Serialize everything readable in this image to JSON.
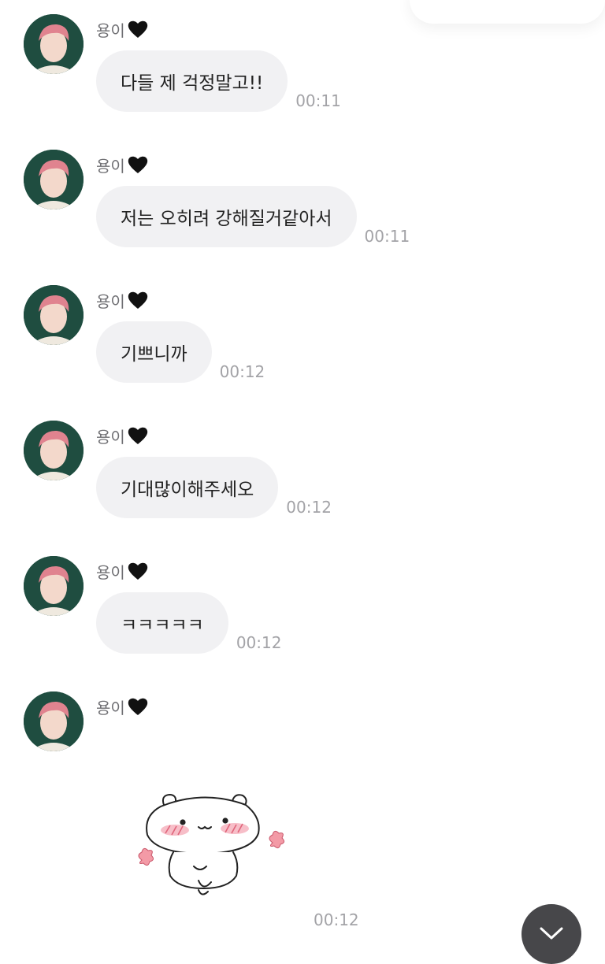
{
  "sender_name": "용이",
  "messages": [
    {
      "text": "다들 제 걱정말고!!",
      "time": "00:11"
    },
    {
      "text": "저는 오히려 강해질거같아서",
      "time": "00:11"
    },
    {
      "text": "기쁘니까",
      "time": "00:12"
    },
    {
      "text": "기대많이해주세오",
      "time": "00:12"
    },
    {
      "text": "ㅋㅋㅋㅋㅋ",
      "time": "00:12"
    }
  ],
  "sticker_message": {
    "sticker": "blushing-bear-sticker",
    "time": "00:12"
  },
  "icons": {
    "heart": "black-heart-icon",
    "scroll": "chevron-down-icon"
  },
  "colors": {
    "bubble": "#f1f1f3",
    "timestamp": "#a3a3a7",
    "scroll_button": "#47474a"
  }
}
